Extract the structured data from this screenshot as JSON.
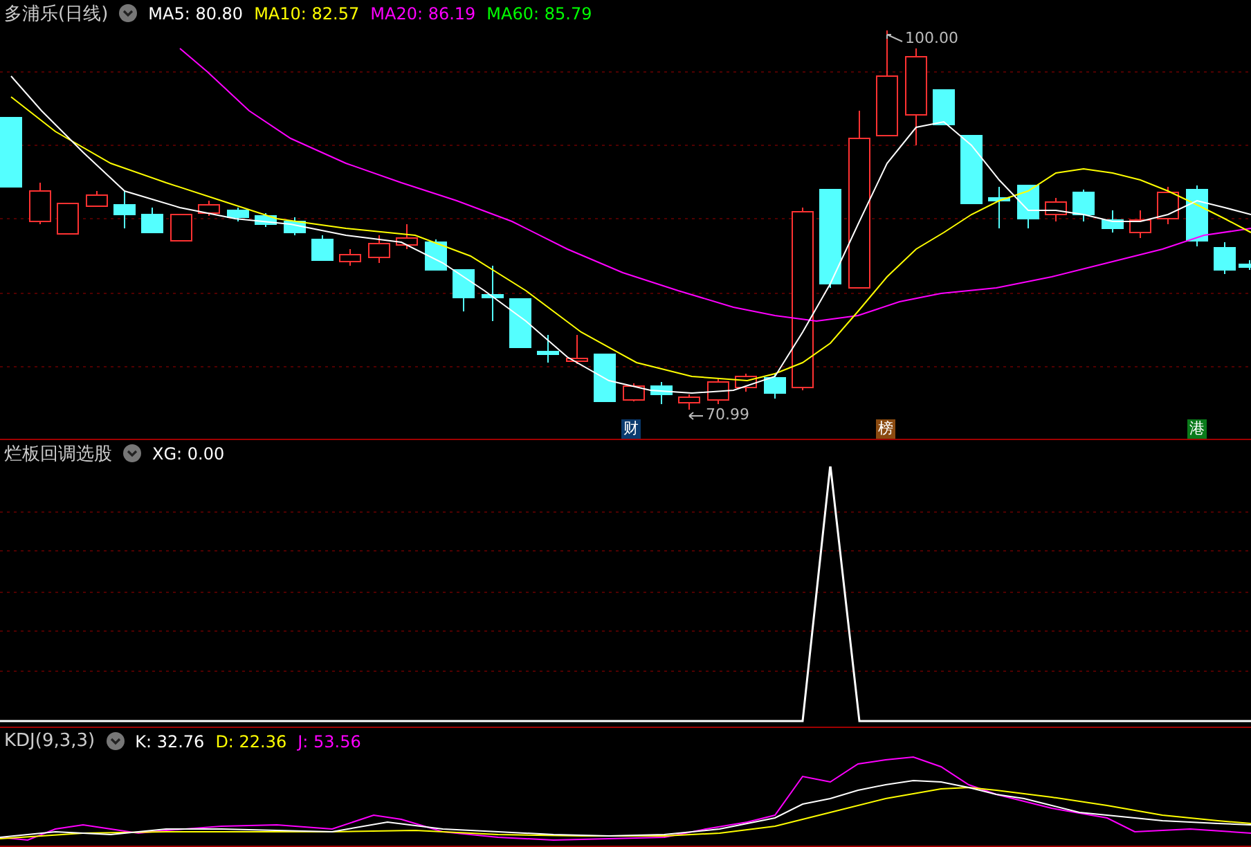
{
  "price_panel": {
    "title": "多浦乐(日线)",
    "legend": [
      {
        "label": "MA5: 80.80",
        "color": "#ffffff"
      },
      {
        "label": "MA10: 82.57",
        "color": "#ffff00"
      },
      {
        "label": "MA20: 86.19",
        "color": "#ff00ff"
      },
      {
        "label": "MA60: 85.79",
        "color": "#00ff00"
      }
    ],
    "high_label": "100.00",
    "low_label": "70.99",
    "markers": [
      {
        "text": "财",
        "color": "#0a3a6e"
      },
      {
        "text": "榜",
        "color": "#8a4a10"
      },
      {
        "text": "港",
        "color": "#0a7a1a"
      }
    ]
  },
  "signal_panel": {
    "title": "烂板回调选股",
    "legend": [
      {
        "label": "XG: 0.00",
        "color": "#ffffff"
      }
    ]
  },
  "kdj_panel": {
    "title": "KDJ(9,3,3)",
    "legend": [
      {
        "label": "K: 32.76",
        "color": "#ffffff"
      },
      {
        "label": "D: 22.36",
        "color": "#ffff00"
      },
      {
        "label": "J: 53.56",
        "color": "#ff00ff"
      }
    ]
  }
}
